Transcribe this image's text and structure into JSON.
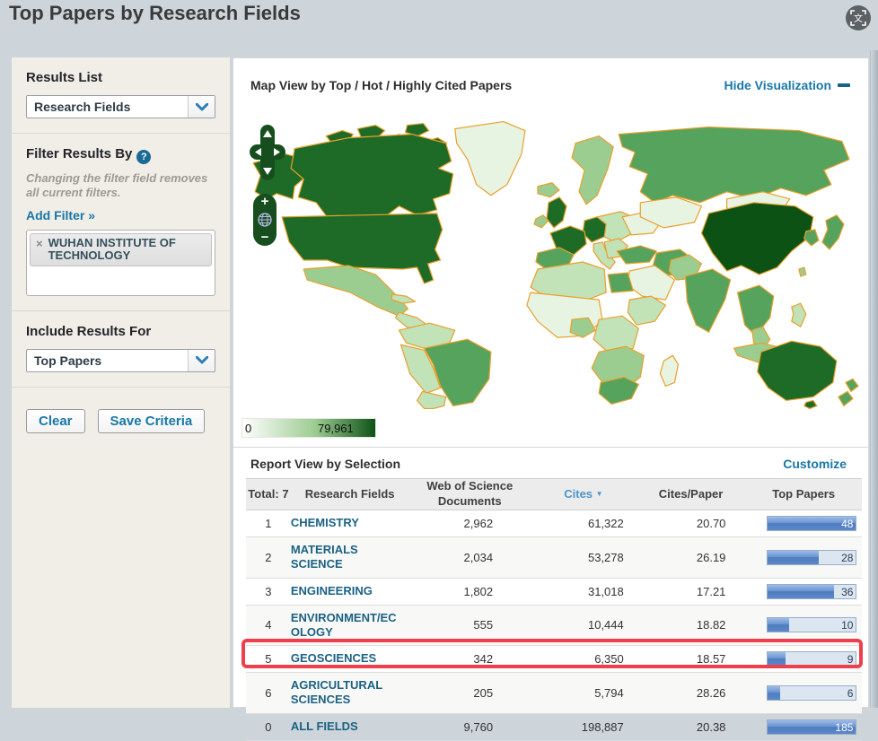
{
  "theme": {
    "page_bg": "#cdd4da",
    "sidebar_bg": "#f0eee7",
    "link_blue": "#1878a8",
    "field_link_blue": "#1b6284",
    "highlight_red": "#ee3f4d",
    "map_border_orange": "#e9a02b",
    "map_green_max": "#0d5215",
    "bar_fill_blue": "#5d88c8"
  },
  "header": {
    "title": "Top Papers by Research Fields",
    "translate_icon_glyph": "文"
  },
  "sidebar": {
    "results_list": {
      "heading": "Results List",
      "selected": "Research Fields"
    },
    "filter": {
      "heading": "Filter Results By",
      "help_icon": "?",
      "note": "Changing the filter field removes all current filters.",
      "add_filter_label": "Add Filter »",
      "chips": [
        {
          "remove_icon": "×",
          "label": "WUHAN INSTITUTE OF TECHNOLOGY"
        }
      ]
    },
    "include_results": {
      "heading": "Include Results For",
      "selected": "Top Papers"
    },
    "actions": {
      "clear_label": "Clear",
      "save_label": "Save Criteria"
    }
  },
  "map_section": {
    "title": "Map View by Top / Hot / Highly Cited Papers",
    "hide_label": "Hide Visualization",
    "legend": {
      "min": "0",
      "max": "79,961"
    },
    "controls": {
      "zoom_in": "+",
      "zoom_out": "−"
    },
    "shading_note": {
      "darkest": [
        "China"
      ],
      "dark": [
        "United States",
        "Canada",
        "Alaska",
        "United Kingdom",
        "France",
        "Germany",
        "Australia"
      ],
      "medium": [
        "Russia",
        "Brazil",
        "India",
        "Japan",
        "Spain",
        "Turkey",
        "Iran",
        "Egypt",
        "South Africa",
        "South Korea",
        "New Zealand"
      ],
      "light": [
        "Mexico",
        "Argentina",
        "Peru",
        "Colombia",
        "Scandinavia",
        "Italy",
        "Eastern Europe",
        "Nigeria",
        "East Africa",
        "Indonesia",
        "Philippines"
      ],
      "palest": [
        "Greenland",
        "Kazakhstan",
        "Mongolia",
        "Saudi Arabia",
        "Sahara region",
        "Madagascar",
        "Ukraine"
      ]
    }
  },
  "report_section": {
    "title": "Report View by Selection",
    "customize_label": "Customize",
    "columns": {
      "total": "Total: 7",
      "fields": "Research Fields",
      "docs": "Web of Science Documents",
      "cites": "Cites",
      "sort_icon": "▼",
      "cites_per_paper": "Cites/Paper",
      "top_papers": "Top Papers"
    },
    "rows": [
      {
        "rank": "1",
        "field": "CHEMISTRY",
        "docs": "2,962",
        "cites": "61,322",
        "cites_per_paper": "20.70",
        "top_papers": "48",
        "bar_pct": 100,
        "highlighted": false
      },
      {
        "rank": "2",
        "field": "MATERIALS SCIENCE",
        "docs": "2,034",
        "cites": "53,278",
        "cites_per_paper": "26.19",
        "top_papers": "28",
        "bar_pct": 58,
        "highlighted": false
      },
      {
        "rank": "3",
        "field": "ENGINEERING",
        "docs": "1,802",
        "cites": "31,018",
        "cites_per_paper": "17.21",
        "top_papers": "36",
        "bar_pct": 75,
        "highlighted": false
      },
      {
        "rank": "4",
        "field": "ENVIRONMENT/ECOLOGY",
        "docs": "555",
        "cites": "10,444",
        "cites_per_paper": "18.82",
        "top_papers": "10",
        "bar_pct": 24,
        "highlighted": false
      },
      {
        "rank": "5",
        "field": "GEOSCIENCES",
        "docs": "342",
        "cites": "6,350",
        "cites_per_paper": "18.57",
        "top_papers": "9",
        "bar_pct": 20,
        "highlighted": true
      },
      {
        "rank": "6",
        "field": "AGRICULTURAL SCIENCES",
        "docs": "205",
        "cites": "5,794",
        "cites_per_paper": "28.26",
        "top_papers": "6",
        "bar_pct": 14,
        "highlighted": false
      },
      {
        "rank": "0",
        "field": "ALL FIELDS",
        "docs": "9,760",
        "cites": "198,887",
        "cites_per_paper": "20.38",
        "top_papers": "185",
        "bar_pct": 100,
        "highlighted": false
      }
    ]
  }
}
